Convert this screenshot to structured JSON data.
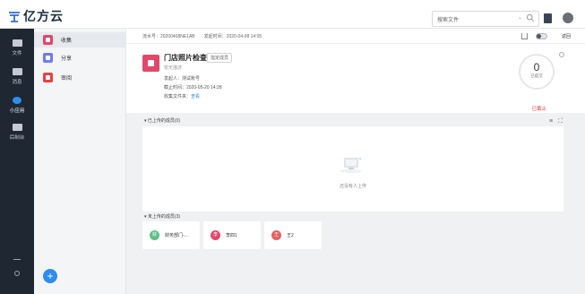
{
  "app": {
    "name": "亿方云"
  },
  "search": {
    "placeholder": "搜索文件"
  },
  "rail": {
    "items": [
      {
        "label": "文件",
        "icon": "folder-icon"
      },
      {
        "label": "消息",
        "icon": "message-icon"
      },
      {
        "label": "小应用",
        "icon": "apps-icon"
      },
      {
        "label": "后制台",
        "icon": "console-icon"
      }
    ]
  },
  "sidebar": {
    "items": [
      {
        "label": "收集",
        "color": "#e2476a"
      },
      {
        "label": "分享",
        "color": "#6d7cf5"
      },
      {
        "label": "审阅",
        "color": "#e64340"
      }
    ]
  },
  "header": {
    "serial": "流水号：20200408NE1AB",
    "start": "发起时间：2020-04-08 14:05",
    "return_label": "返回"
  },
  "task": {
    "title": "门店照片检查",
    "tag": "指定成员",
    "subtitle": "暂无描述",
    "initiator": "发起人：测试账号",
    "deadline": "截止时间：2020-05-20 14:28",
    "folder_prefix": "收集文件夹：",
    "folder_link": "查看",
    "count": "0",
    "count_label": "已提交",
    "status": "已截止"
  },
  "uploaded": {
    "title": "已上传的成员(0)",
    "empty_text": "还没有人上传"
  },
  "not_uploaded": {
    "title": "未上传的成员(3)",
    "members": [
      {
        "avatar": "财",
        "name": "财务部门-...",
        "color": "#5fbf8a"
      },
      {
        "avatar": "李",
        "name": "李四1",
        "color": "#e2476a"
      },
      {
        "avatar": "王",
        "name": "王2",
        "color": "#e66060"
      }
    ]
  }
}
